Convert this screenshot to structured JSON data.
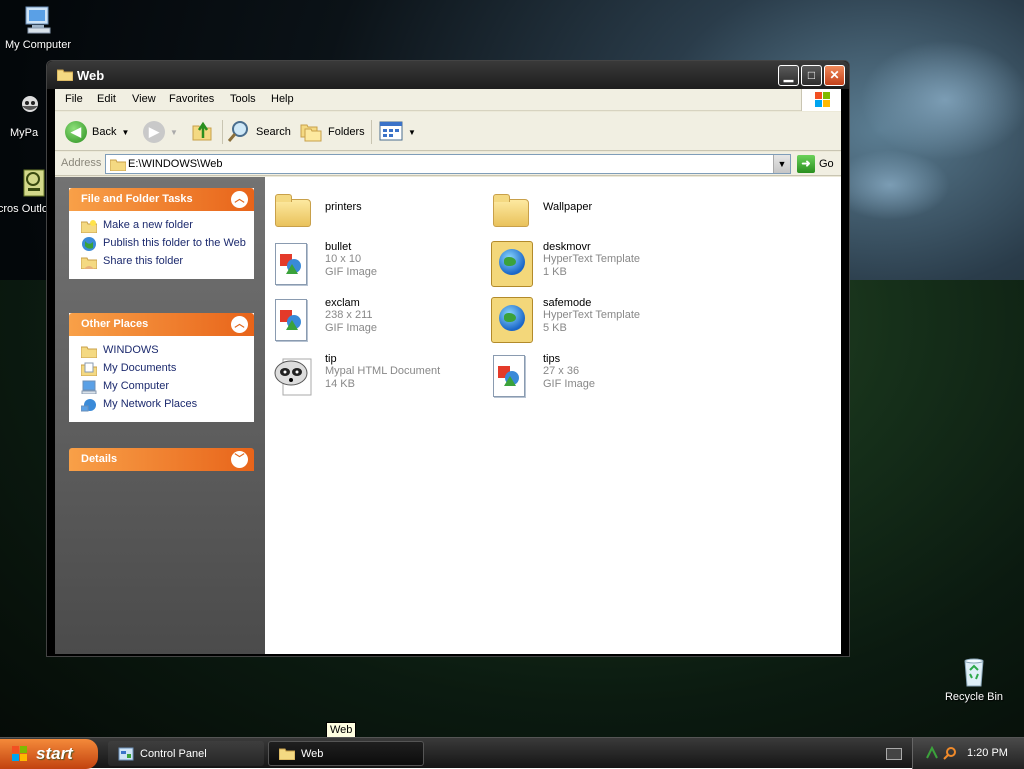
{
  "desktop": {
    "icons": [
      {
        "label": "My Computer",
        "icon": "my-computer-icon"
      },
      {
        "label": "MyPa",
        "icon": "mypal-icon"
      },
      {
        "label": "Micros Outlo",
        "icon": "outlook-icon"
      },
      {
        "label": "Recycle Bin",
        "icon": "recycle-bin-icon"
      }
    ]
  },
  "window": {
    "title": "Web",
    "menu": [
      "File",
      "Edit",
      "View",
      "Favorites",
      "Tools",
      "Help"
    ],
    "toolbar": {
      "back": "Back",
      "search": "Search",
      "folders": "Folders"
    },
    "address": {
      "label": "Address",
      "value": "E:\\WINDOWS\\Web",
      "go": "Go"
    }
  },
  "tasks": {
    "file_folder": {
      "title": "File and Folder Tasks",
      "items": [
        "Make a new folder",
        "Publish this folder to the Web",
        "Share this folder"
      ]
    },
    "other_places": {
      "title": "Other Places",
      "items": [
        "WINDOWS",
        "My Documents",
        "My Computer",
        "My Network Places"
      ]
    },
    "details": {
      "title": "Details"
    }
  },
  "files": [
    {
      "name": "printers",
      "line1": "",
      "line2": "",
      "kind": "folder"
    },
    {
      "name": "Wallpaper",
      "line1": "",
      "line2": "",
      "kind": "folder"
    },
    {
      "name": "bullet",
      "line1": "10 x 10",
      "line2": "GIF Image",
      "kind": "gif"
    },
    {
      "name": "deskmovr",
      "line1": "HyperText Template",
      "line2": "1 KB",
      "kind": "htt"
    },
    {
      "name": "exclam",
      "line1": "238 x 211",
      "line2": "GIF Image",
      "kind": "gif"
    },
    {
      "name": "safemode",
      "line1": "HyperText Template",
      "line2": "5 KB",
      "kind": "htt"
    },
    {
      "name": "tip",
      "line1": "Mypal HTML Document",
      "line2": "14 KB",
      "kind": "mypal"
    },
    {
      "name": "tips",
      "line1": "27 x 36",
      "line2": "GIF Image",
      "kind": "gif"
    }
  ],
  "taskbar": {
    "start": "start",
    "buttons": [
      "Control Panel",
      "Web"
    ],
    "clock": "1:20 PM",
    "tooltip": "Web"
  },
  "colors": {
    "accent": "#e8641a",
    "link": "#1c2a6e",
    "meta": "#888888"
  }
}
